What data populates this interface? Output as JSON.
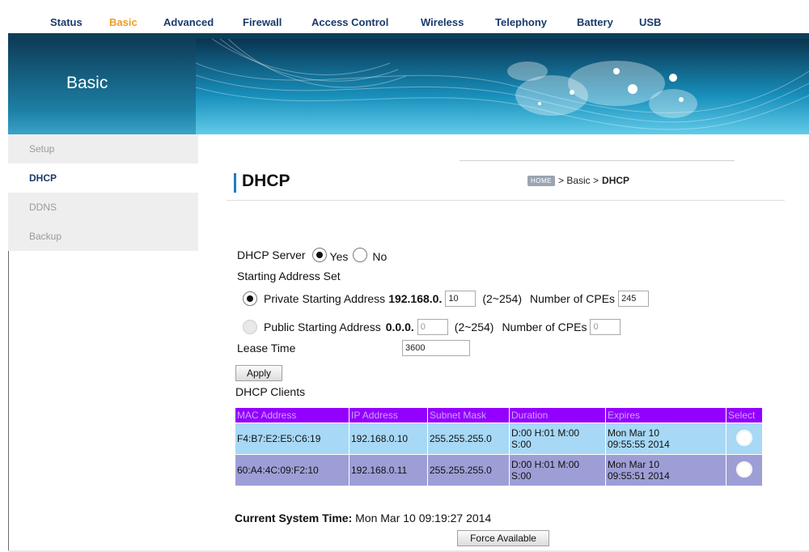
{
  "nav": {
    "items": [
      "Status",
      "Basic",
      "Advanced",
      "Firewall",
      "Access Control",
      "Wireless",
      "Telephony",
      "Battery",
      "USB"
    ],
    "active": "Basic"
  },
  "banner": {
    "title": "Basic"
  },
  "sidebar": {
    "items": [
      {
        "label": "Setup",
        "active": false
      },
      {
        "label": "DHCP",
        "active": true
      },
      {
        "label": "DDNS",
        "active": false
      },
      {
        "label": "Backup",
        "active": false
      }
    ]
  },
  "page": {
    "title": "DHCP",
    "breadcrumb": {
      "home": "HOME",
      "sep1": "> Basic >",
      "current": "DHCP"
    }
  },
  "dhcp_server": {
    "label": "DHCP Server",
    "yes": "Yes",
    "no": "No",
    "selected": "Yes"
  },
  "starting_address": {
    "heading": "Starting Address Set",
    "private": {
      "label": "Private Starting Address",
      "prefix": "192.168.0.",
      "value": "10",
      "range": "(2~254)",
      "cpes_label": "Number of CPEs",
      "cpes_value": "245",
      "selected": true
    },
    "public": {
      "label": "Public Starting Address",
      "prefix": "0.0.0.",
      "value": "0",
      "range": "(2~254)",
      "cpes_label": "Number of CPEs",
      "cpes_value": "0",
      "selected": false
    }
  },
  "lease": {
    "label": "Lease Time",
    "value": "3600"
  },
  "buttons": {
    "apply": "Apply",
    "force_available": "Force Available"
  },
  "clients": {
    "heading": "DHCP Clients",
    "columns": [
      "MAC Address",
      "IP Address",
      "Subnet Mask",
      "Duration",
      "Expires",
      "Select"
    ],
    "rows": [
      {
        "mac": "F4:B7:E2:E5:C6:19",
        "ip": "192.168.0.10",
        "mask": "255.255.255.0",
        "duration1": "D:00 H:01 M:00",
        "duration2": "S:00",
        "expires1": "Mon Mar 10",
        "expires2": "09:55:55 2014"
      },
      {
        "mac": "60:A4:4C:09:F2:10",
        "ip": "192.168.0.11",
        "mask": "255.255.255.0",
        "duration1": "D:00 H:01 M:00",
        "duration2": "S:00",
        "expires1": "Mon Mar 10",
        "expires2": "09:55:51 2014"
      }
    ]
  },
  "system_time": {
    "label": "Current System Time:",
    "value": "Mon Mar 10 09:19:27 2014"
  },
  "colors": {
    "nav_active": "#f39c1e",
    "nav_text": "#1a3a6a",
    "table_header": "#9400ff",
    "row1": "#a7d8f5",
    "row2": "#9e9ed6"
  }
}
